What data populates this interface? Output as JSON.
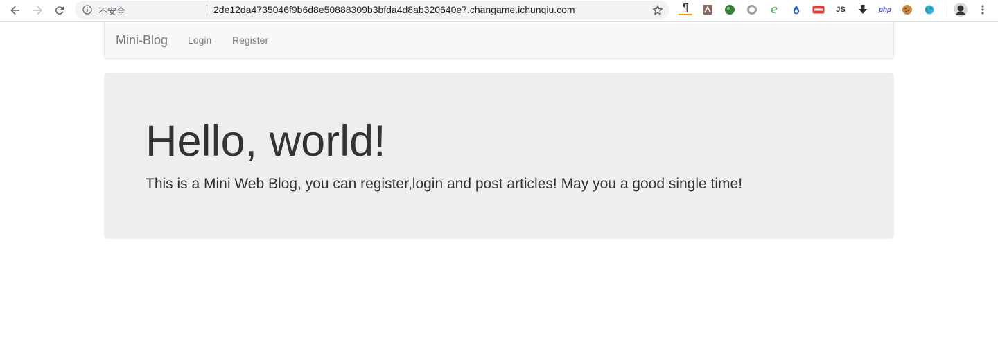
{
  "browser": {
    "security_label": "不安全",
    "url": "2de12da4735046f9b6d8e50888309b3bfda4d8ab320640e7.changame.ichunqiu.com",
    "extensions": [
      {
        "name": "paragraph-extension-icon",
        "glyph": "¶",
        "color": "#333333"
      },
      {
        "name": "pdf-extension-icon",
        "glyph": "",
        "color": "#8b6b61"
      },
      {
        "name": "green-orb-extension-icon",
        "glyph": "",
        "color": "#2e7d32"
      },
      {
        "name": "ring-extension-icon",
        "glyph": "",
        "color": "#9e9e9e"
      },
      {
        "name": "e-extension-icon",
        "glyph": "e",
        "color": "#4caf50"
      },
      {
        "name": "drop-extension-icon",
        "glyph": "",
        "color": "#1565c0"
      },
      {
        "name": "badge-extension-icon",
        "glyph": "",
        "color": "#e53935"
      },
      {
        "name": "js-extension-icon",
        "glyph": "JS",
        "color": "#333333"
      },
      {
        "name": "download-arrow-extension-icon",
        "glyph": "",
        "color": "#333333"
      },
      {
        "name": "php-extension-icon",
        "glyph": "php",
        "color": "#3f51b5"
      },
      {
        "name": "cookie-extension-icon",
        "glyph": "",
        "color": "#c8873c"
      },
      {
        "name": "globe-extension-icon",
        "glyph": "",
        "color": "#558b2f"
      }
    ]
  },
  "navbar": {
    "brand": "Mini-Blog",
    "links": [
      "Login",
      "Register"
    ]
  },
  "jumbotron": {
    "title": "Hello, world!",
    "text": "This is a Mini Web Blog, you can register,login and post articles! May you a good single time!"
  }
}
